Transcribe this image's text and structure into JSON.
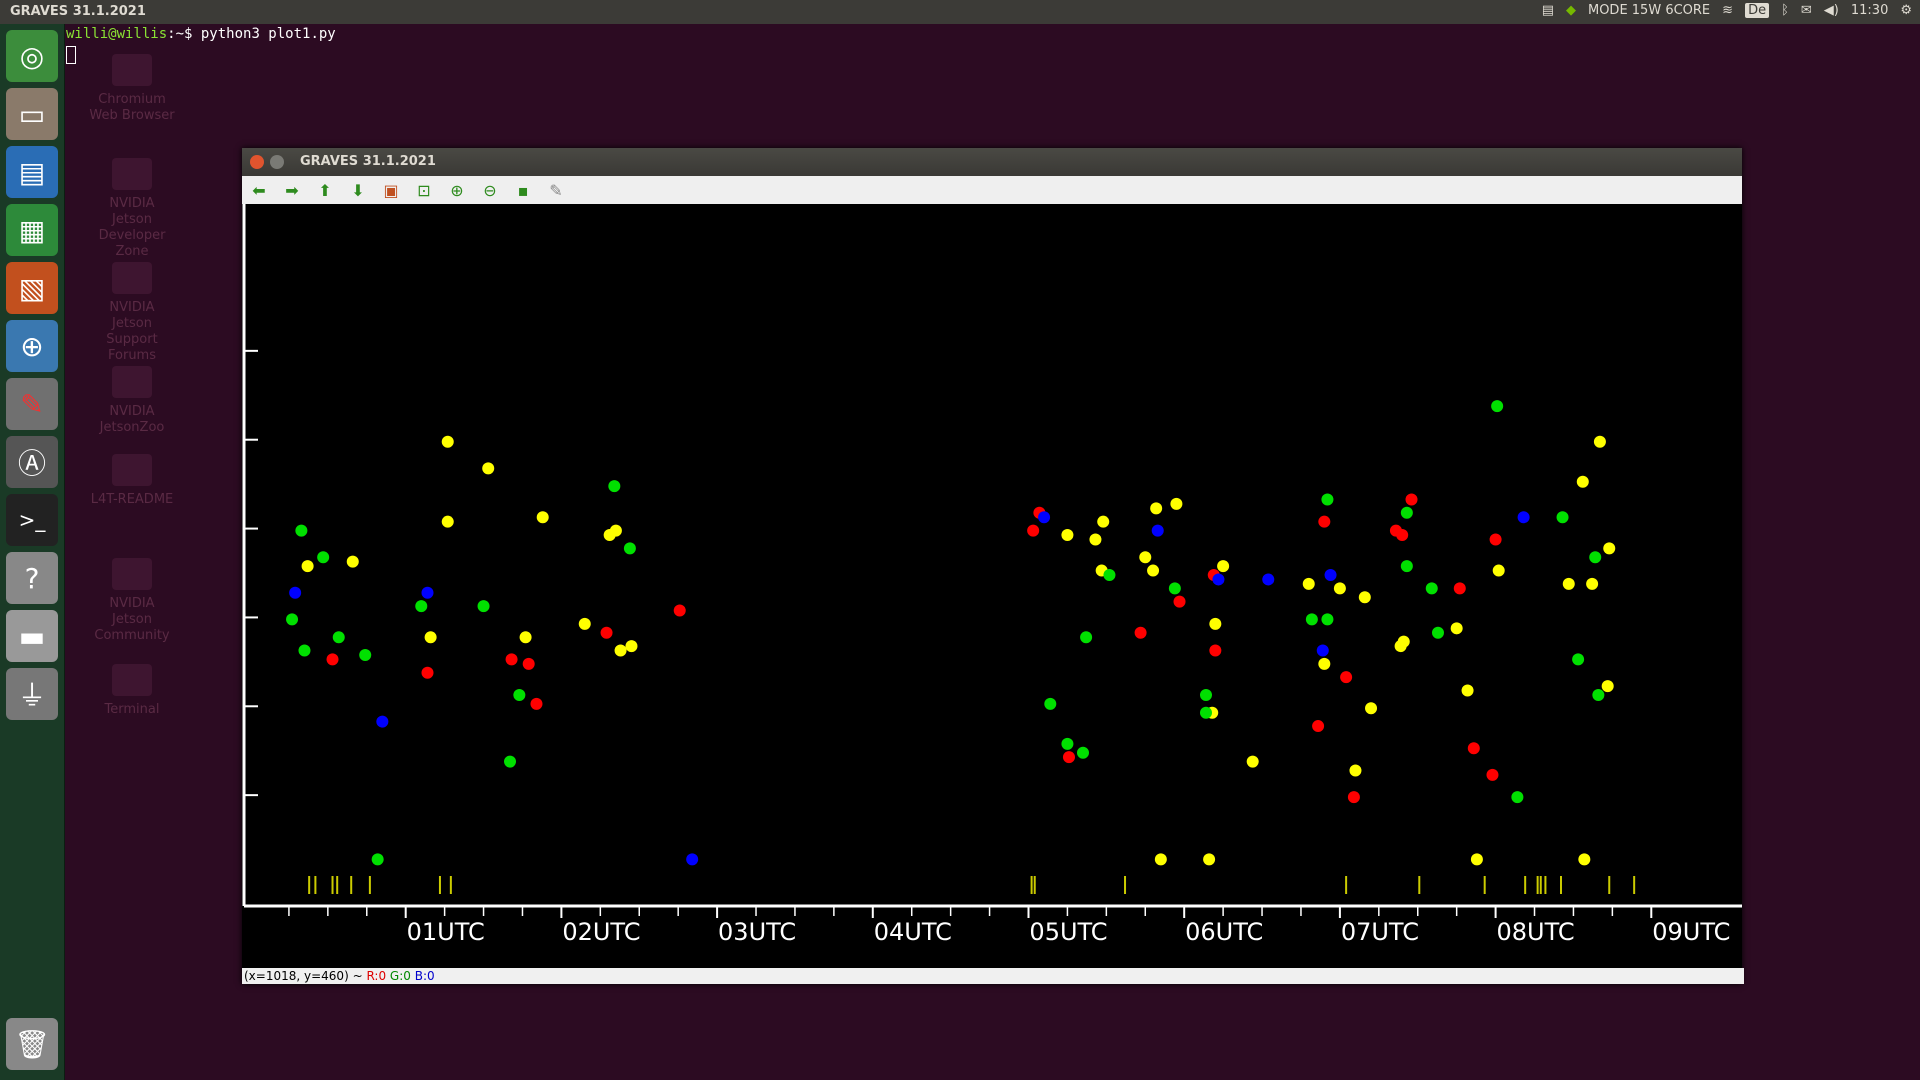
{
  "topbar": {
    "title": "GRAVES 31.1.2021",
    "mode": "MODE 15W 6CORE",
    "keyboard": "De",
    "time": "11:30"
  },
  "launcher": {
    "items": [
      "ubuntu-dash",
      "files",
      "writer",
      "calc",
      "impress",
      "software-center",
      "system-settings",
      "software-updater",
      "terminal",
      "help",
      "drive",
      "usb",
      "trash"
    ]
  },
  "desktop": {
    "icons": [
      {
        "label": "Chromium Web Browser"
      },
      {
        "label": "NVIDIA Jetson Developer Zone"
      },
      {
        "label": "NVIDIA Jetson Support Forums"
      },
      {
        "label": "NVIDIA JetsonZoo"
      },
      {
        "label": "L4T-README"
      },
      {
        "label": "NVIDIA Jetson Community"
      },
      {
        "label": "Terminal"
      }
    ]
  },
  "terminal": {
    "prompt": "willi@willis",
    "path": ":~$ ",
    "command": "python3 plot1.py"
  },
  "window": {
    "title": "GRAVES 31.1.2021",
    "toolbar": [
      "back-icon",
      "forward-icon",
      "up-icon",
      "down-icon",
      "image-icon",
      "configure-icon",
      "zoom-in-icon",
      "zoom-out-icon",
      "save-icon",
      "edit-icon"
    ],
    "status": {
      "coords": "(x=1018, y=460) ~ ",
      "r": "R:0",
      "g": "G:0",
      "b": "B:0"
    }
  },
  "colors": {
    "red": "#ff0000",
    "green": "#00e000",
    "blue": "#0000ff",
    "yellow": "#ffff00"
  },
  "chart_data": {
    "type": "scatter",
    "title": "",
    "xlabel": "",
    "ylabel": "",
    "xlim": [
      0.0,
      9.3
    ],
    "ylim": [
      0,
      7
    ],
    "x_ticks": [
      {
        "x": 1,
        "label": "01UTC"
      },
      {
        "x": 2,
        "label": "02UTC"
      },
      {
        "x": 3,
        "label": "03UTC"
      },
      {
        "x": 4,
        "label": "04UTC"
      },
      {
        "x": 5,
        "label": "05UTC"
      },
      {
        "x": 6,
        "label": "06UTC"
      },
      {
        "x": 7,
        "label": "07UTC"
      },
      {
        "x": 8,
        "label": "08UTC"
      },
      {
        "x": 9,
        "label": "09UTC"
      }
    ],
    "grid": false,
    "series": [
      {
        "color": "yellow",
        "points": [
          [
            0.37,
            3.6
          ],
          [
            0.66,
            3.65
          ],
          [
            1.16,
            2.8
          ],
          [
            1.27,
            5.0
          ],
          [
            1.27,
            4.1
          ],
          [
            1.53,
            4.7
          ],
          [
            1.77,
            2.8
          ],
          [
            1.88,
            4.15
          ],
          [
            2.15,
            2.95
          ],
          [
            2.31,
            3.95
          ],
          [
            2.35,
            4.0
          ],
          [
            2.38,
            2.65
          ],
          [
            2.45,
            2.7
          ],
          [
            5.25,
            3.95
          ],
          [
            5.43,
            3.9
          ],
          [
            5.48,
            4.1
          ],
          [
            5.47,
            3.55
          ],
          [
            5.75,
            3.7
          ],
          [
            5.8,
            3.55
          ],
          [
            5.82,
            4.25
          ],
          [
            5.95,
            4.3
          ],
          [
            5.85,
            0.3
          ],
          [
            6.16,
            0.3
          ],
          [
            6.2,
            2.95
          ],
          [
            6.25,
            3.6
          ],
          [
            6.18,
            1.95
          ],
          [
            6.44,
            1.4
          ],
          [
            6.8,
            3.4
          ],
          [
            6.9,
            2.5
          ],
          [
            7.0,
            3.35
          ],
          [
            7.1,
            1.3
          ],
          [
            7.16,
            3.25
          ],
          [
            7.2,
            2.0
          ],
          [
            7.39,
            2.7
          ],
          [
            7.41,
            2.75
          ],
          [
            7.75,
            2.9
          ],
          [
            7.82,
            2.2
          ],
          [
            7.88,
            0.3
          ],
          [
            8.02,
            3.55
          ],
          [
            8.57,
            0.3
          ],
          [
            8.47,
            3.4
          ],
          [
            8.56,
            4.55
          ],
          [
            8.62,
            3.4
          ],
          [
            8.67,
            5.0
          ],
          [
            8.72,
            2.25
          ],
          [
            8.73,
            3.8
          ]
        ]
      },
      {
        "color": "green",
        "points": [
          [
            0.33,
            4.0
          ],
          [
            0.47,
            3.7
          ],
          [
            0.27,
            3.0
          ],
          [
            0.35,
            2.65
          ],
          [
            0.57,
            2.8
          ],
          [
            0.74,
            2.6
          ],
          [
            0.82,
            0.3
          ],
          [
            1.1,
            3.15
          ],
          [
            1.5,
            3.15
          ],
          [
            1.73,
            2.15
          ],
          [
            1.67,
            1.4
          ],
          [
            2.34,
            4.5
          ],
          [
            2.44,
            3.8
          ],
          [
            5.37,
            2.8
          ],
          [
            5.14,
            2.05
          ],
          [
            5.25,
            1.6
          ],
          [
            5.35,
            1.5
          ],
          [
            5.52,
            3.5
          ],
          [
            5.94,
            3.35
          ],
          [
            6.14,
            2.15
          ],
          [
            6.14,
            1.95
          ],
          [
            6.82,
            3.0
          ],
          [
            6.92,
            4.35
          ],
          [
            6.92,
            3.0
          ],
          [
            7.43,
            4.2
          ],
          [
            7.43,
            3.6
          ],
          [
            7.59,
            3.35
          ],
          [
            7.63,
            2.85
          ],
          [
            8.01,
            5.4
          ],
          [
            8.14,
            1.0
          ],
          [
            8.43,
            4.15
          ],
          [
            8.53,
            2.55
          ],
          [
            8.64,
            3.7
          ],
          [
            8.66,
            2.15
          ]
        ]
      },
      {
        "color": "red",
        "points": [
          [
            0.53,
            2.55
          ],
          [
            1.14,
            2.4
          ],
          [
            1.68,
            2.55
          ],
          [
            1.79,
            2.5
          ],
          [
            1.84,
            2.05
          ],
          [
            2.29,
            2.85
          ],
          [
            2.76,
            3.1
          ],
          [
            5.07,
            4.2
          ],
          [
            5.03,
            4.0
          ],
          [
            5.26,
            1.45
          ],
          [
            5.72,
            2.85
          ],
          [
            5.97,
            3.2
          ],
          [
            6.19,
            3.5
          ],
          [
            6.2,
            2.65
          ],
          [
            6.86,
            1.8
          ],
          [
            6.9,
            4.1
          ],
          [
            7.04,
            2.35
          ],
          [
            7.09,
            1.0
          ],
          [
            7.36,
            4.0
          ],
          [
            7.4,
            3.95
          ],
          [
            7.46,
            4.35
          ],
          [
            7.77,
            3.35
          ],
          [
            7.86,
            1.55
          ],
          [
            7.98,
            1.25
          ],
          [
            8.0,
            3.9
          ]
        ]
      },
      {
        "color": "blue",
        "points": [
          [
            0.29,
            3.3
          ],
          [
            1.14,
            3.3
          ],
          [
            0.85,
            1.85
          ],
          [
            2.84,
            0.3
          ],
          [
            5.1,
            4.15
          ],
          [
            5.83,
            4.0
          ],
          [
            6.22,
            3.45
          ],
          [
            6.54,
            3.45
          ],
          [
            6.94,
            3.5
          ],
          [
            6.89,
            2.65
          ],
          [
            8.18,
            4.15
          ]
        ]
      }
    ]
  }
}
